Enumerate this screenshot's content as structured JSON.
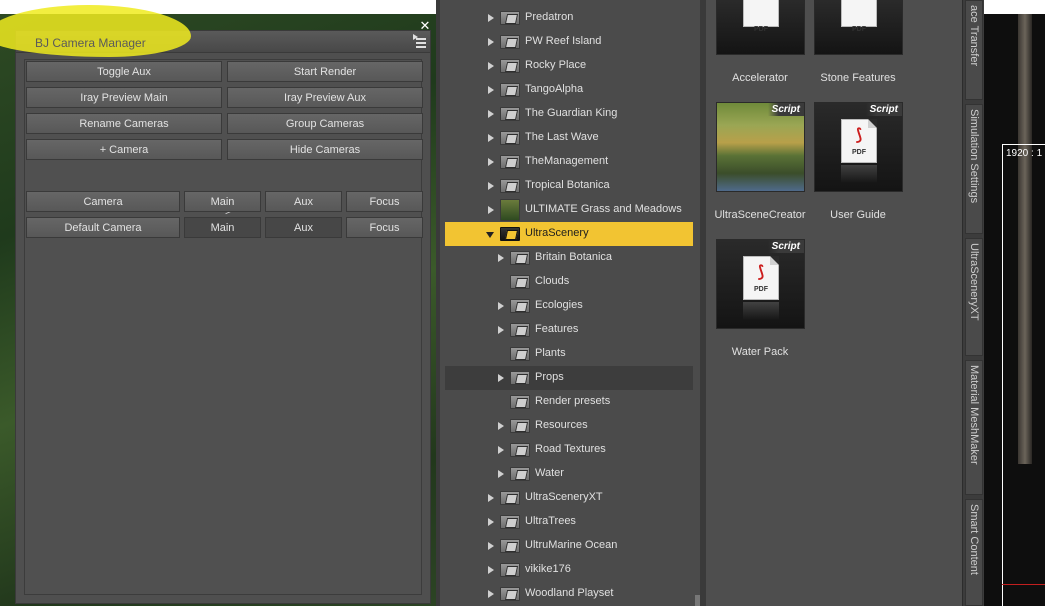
{
  "camera_manager": {
    "title": "BJ Camera Manager",
    "close_glyph": "✕",
    "buttons": {
      "toggle_aux": "Toggle Aux",
      "start_render": "Start Render",
      "iray_preview_main": "Iray Preview Main",
      "iray_preview_aux": "Iray Preview Aux",
      "rename_cameras": "Rename Cameras",
      "group_cameras": "Group Cameras",
      "add_camera": "+ Camera",
      "hide_cameras": "Hide Cameras"
    },
    "expand_arrow": ">",
    "camera_rows": [
      {
        "name": "Camera",
        "main": "Main",
        "aux": "Aux",
        "focus": "Focus"
      },
      {
        "name": "Default Camera",
        "main": "Main",
        "aux": "Aux",
        "focus": "Focus"
      }
    ]
  },
  "content_tree": {
    "items": [
      {
        "label": "Predatron"
      },
      {
        "label": "PW Reef Island"
      },
      {
        "label": "Rocky Place"
      },
      {
        "label": "TangoAlpha"
      },
      {
        "label": "The Guardian King"
      },
      {
        "label": "The Last Wave"
      },
      {
        "label": "TheManagement"
      },
      {
        "label": "Tropical Botanica"
      },
      {
        "label": "ULTIMATE Grass and Meadows"
      },
      {
        "label": "UltraScenery"
      },
      {
        "label": "Britain Botanica"
      },
      {
        "label": "Clouds"
      },
      {
        "label": "Ecologies"
      },
      {
        "label": "Features"
      },
      {
        "label": "Plants"
      },
      {
        "label": "Props"
      },
      {
        "label": "Render presets"
      },
      {
        "label": "Resources"
      },
      {
        "label": "Road Textures"
      },
      {
        "label": "Water"
      },
      {
        "label": "UltraSceneryXT"
      },
      {
        "label": "UltraTrees"
      },
      {
        "label": "UltruMarine Ocean"
      },
      {
        "label": "vikike176"
      },
      {
        "label": "Woodland Playset"
      }
    ]
  },
  "files": {
    "script_badge": "Script",
    "pdf_label": "PDF",
    "items": [
      {
        "label": "Accelerator"
      },
      {
        "label": "Stone Features"
      },
      {
        "label": "UltraSceneCreator"
      },
      {
        "label": "User Guide"
      },
      {
        "label": "Water Pack"
      }
    ]
  },
  "side_tabs": [
    {
      "label": "ace Transfer"
    },
    {
      "label": "Simulation Settings"
    },
    {
      "label": "UltraSceneryXT"
    },
    {
      "label": "Material MeshMaker"
    },
    {
      "label": "Smart Content"
    }
  ],
  "viewport": {
    "resolution_text": "1920 : 1"
  },
  "colors": {
    "selected_row": "#f2c432",
    "highlight_marker": "#f0eb1e",
    "panel_bg": "#4f4f4f"
  }
}
